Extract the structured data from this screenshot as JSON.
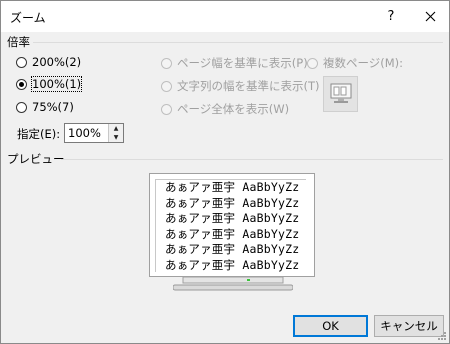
{
  "dialog": {
    "title": "ズーム",
    "help": "?"
  },
  "zoom_to": {
    "label": "倍率"
  },
  "options": {
    "p200": "200%(2)",
    "p100": "100%(1)",
    "p75": "75%(7)",
    "page_width": "ページ幅を基準に表示(P)",
    "text_width": "文字列の幅を基準に表示(T)",
    "whole_page": "ページ全体を表示(W)",
    "many_pages": "複数ページ(M):"
  },
  "percent": {
    "label": "指定(E):",
    "value": "100%"
  },
  "preview": {
    "label": "プレビュー",
    "lines": [
      "あぁアァ亜宇 AaBbYyZz",
      "あぁアァ亜宇 AaBbYyZz",
      "あぁアァ亜宇 AaBbYyZz",
      "あぁアァ亜宇 AaBbYyZz",
      "あぁアァ亜宇 AaBbYyZz",
      "あぁアァ亜宇 AaBbYyZz"
    ]
  },
  "buttons": {
    "ok": "OK",
    "cancel": "キャンセル"
  }
}
